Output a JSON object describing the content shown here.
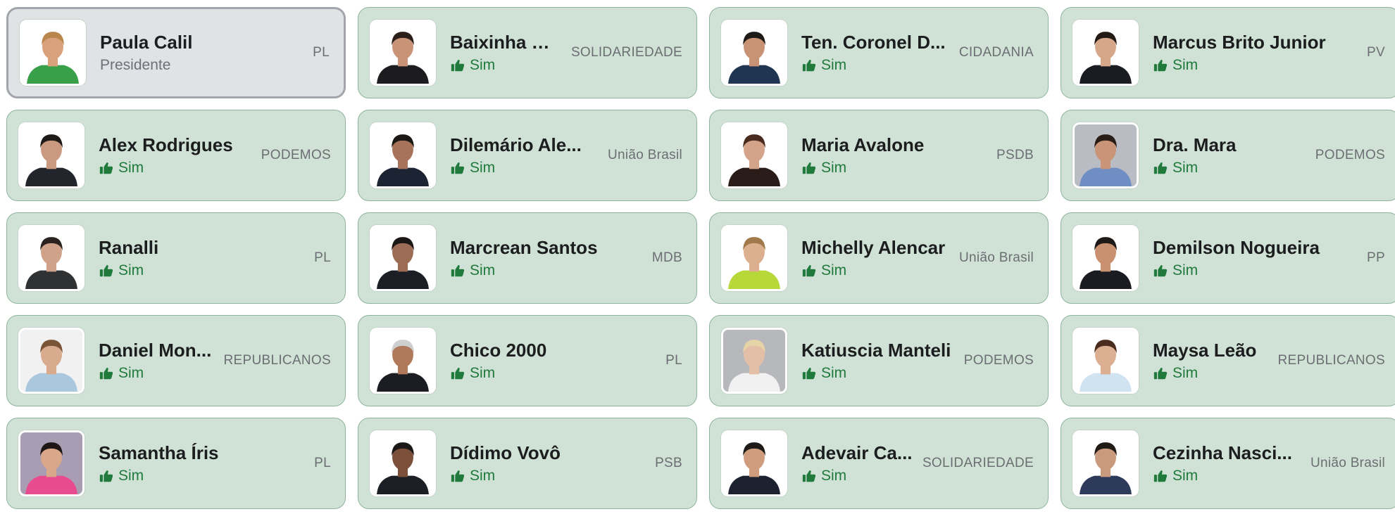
{
  "vote_label": "Sim",
  "members": [
    {
      "name": "Paula Calil",
      "role": "Presidente",
      "party": "PL",
      "president": true,
      "photo": {
        "bg": "#ffffff",
        "skin": "#d9a27c",
        "hair": "#b9874e",
        "suit": "#39a04a"
      }
    },
    {
      "name": "Baixinha Gi...",
      "party": "SOLIDARIEDADE",
      "photo": {
        "bg": "#ffffff",
        "skin": "#c99377",
        "hair": "#2b1d18",
        "suit": "#1c1c1f"
      }
    },
    {
      "name": "Ten. Coronel D...",
      "party": "CIDADANIA",
      "photo": {
        "bg": "#ffffff",
        "skin": "#c89275",
        "hair": "#1e1a18",
        "suit": "#1f3552"
      }
    },
    {
      "name": "Marcus Brito Junior",
      "party": "PV",
      "photo": {
        "bg": "#ffffff",
        "skin": "#d6a789",
        "hair": "#231a15",
        "suit": "#1a1c22"
      }
    },
    {
      "name": "Alex Rodrigues",
      "party": "PODEMOS",
      "photo": {
        "bg": "#ffffff",
        "skin": "#c99a80",
        "hair": "#1d1a18",
        "suit": "#22252b"
      }
    },
    {
      "name": "Dilemário Ale...",
      "party": "União Brasil",
      "photo": {
        "bg": "#ffffff",
        "skin": "#a7735a",
        "hair": "#1b1816",
        "suit": "#1c2433"
      }
    },
    {
      "name": "Maria Avalone",
      "party": "PSDB",
      "photo": {
        "bg": "#ffffff",
        "skin": "#d3a48a",
        "hair": "#4a2c1e",
        "suit": "#2a1d19"
      }
    },
    {
      "name": "Dra. Mara",
      "party": "PODEMOS",
      "photo": {
        "bg": "#b9bdc3",
        "skin": "#c99477",
        "hair": "#2a1d17",
        "suit": "#6f8fc4"
      }
    },
    {
      "name": "Ranalli",
      "party": "PL",
      "photo": {
        "bg": "#ffffff",
        "skin": "#d0a28a",
        "hair": "#2b231f",
        "suit": "#2f3133"
      }
    },
    {
      "name": "Marcrean Santos",
      "party": "MDB",
      "photo": {
        "bg": "#ffffff",
        "skin": "#9d6c55",
        "hair": "#1a1716",
        "suit": "#1b1e25"
      }
    },
    {
      "name": "Michelly Alencar",
      "party": "União Brasil",
      "photo": {
        "bg": "#ffffff",
        "skin": "#dcb08f",
        "hair": "#a07a4a",
        "suit": "#b6d839"
      }
    },
    {
      "name": "Demilson Nogueira",
      "party": "PP",
      "photo": {
        "bg": "#ffffff",
        "skin": "#c9916f",
        "hair": "#1e1a17",
        "suit": "#1a1c22"
      }
    },
    {
      "name": "Daniel Mon...",
      "party": "REPUBLICANOS",
      "photo": {
        "bg": "#f1f1f1",
        "skin": "#d8ab8e",
        "hair": "#7a5436",
        "suit": "#a9c8de"
      }
    },
    {
      "name": "Chico 2000",
      "party": "PL",
      "photo": {
        "bg": "#ffffff",
        "skin": "#b0795b",
        "hair": "#cfcfcf",
        "suit": "#1b1d22"
      }
    },
    {
      "name": "Katiuscia Manteli",
      "party": "PODEMOS",
      "photo": {
        "bg": "#b6b8bb",
        "skin": "#e2bfa6",
        "hair": "#e6d3a8",
        "suit": "#f1f1f1"
      }
    },
    {
      "name": "Maysa Leão",
      "party": "REPUBLICANOS",
      "photo": {
        "bg": "#ffffff",
        "skin": "#dcae92",
        "hair": "#4a2c1e",
        "suit": "#cfe3f1"
      }
    },
    {
      "name": "Samantha Íris",
      "party": "PL",
      "photo": {
        "bg": "#a89db3",
        "skin": "#d9a78a",
        "hair": "#1d1614",
        "suit": "#e94c8e"
      }
    },
    {
      "name": "Dídimo Vovô",
      "party": "PSB",
      "photo": {
        "bg": "#ffffff",
        "skin": "#7c4f3a",
        "hair": "#1a1716",
        "suit": "#1b1e25"
      }
    },
    {
      "name": "Adevair Ca...",
      "party": "SOLIDARIEDADE",
      "photo": {
        "bg": "#ffffff",
        "skin": "#cf9c7e",
        "hair": "#1e1a17",
        "suit": "#1c2230"
      }
    },
    {
      "name": "Cezinha Nasci...",
      "party": "União Brasil",
      "photo": {
        "bg": "#ffffff",
        "skin": "#c99a7e",
        "hair": "#1f1a16",
        "suit": "#2d3a5a"
      }
    }
  ],
  "colors": {
    "card_bg": "#d0e1d6",
    "card_border": "#8fb49d",
    "president_bg": "#e1e2e5",
    "vote": "#1f7a3c"
  },
  "icons": {
    "vote": "thumbs-up-icon"
  }
}
